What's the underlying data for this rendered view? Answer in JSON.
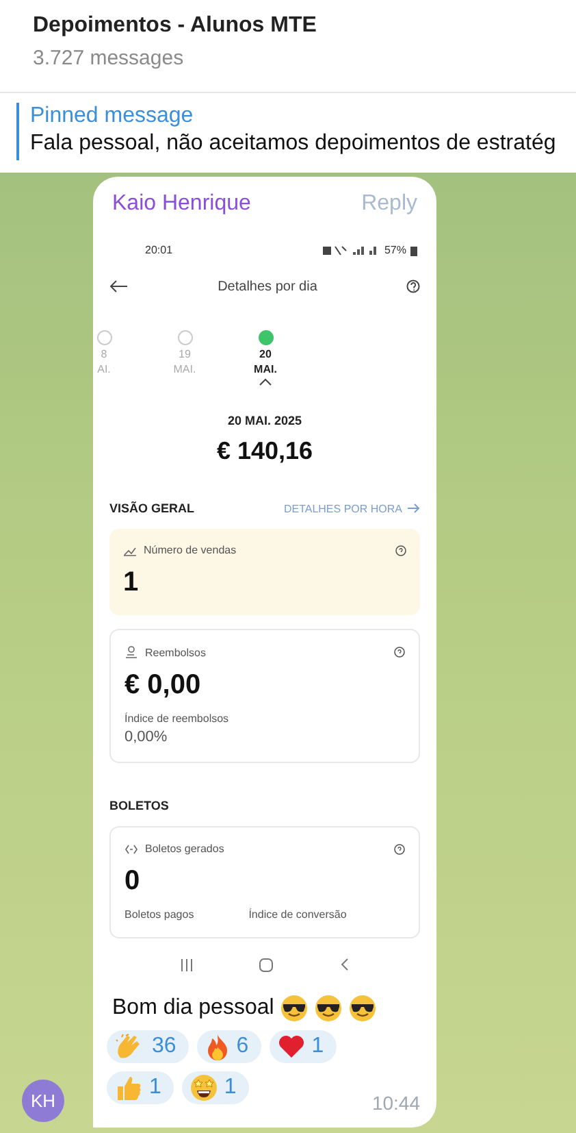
{
  "chat": {
    "title": "Depoimentos - Alunos MTE",
    "subtitle": "3.727 messages"
  },
  "pinned": {
    "label": "Pinned message",
    "text": "Fala pessoal, não aceitamos depoimentos de estratég"
  },
  "message": {
    "sender": "Kaio Henrique",
    "reply": "Reply",
    "avatar": "KH",
    "text": "Bom dia pessoal",
    "time": "10:44",
    "emojis": [
      {
        "kind": "sunglasses"
      },
      {
        "kind": "sunglasses"
      },
      {
        "kind": "sunglasses"
      }
    ],
    "reactions": [
      {
        "kind": "clap",
        "count": "36"
      },
      {
        "kind": "fire",
        "count": "6"
      },
      {
        "kind": "heart",
        "count": "1"
      },
      {
        "kind": "thumbs",
        "count": "1"
      },
      {
        "kind": "starstruck",
        "count": "1"
      }
    ],
    "screenshot": {
      "status_time": "20:01",
      "battery": "57%",
      "title": "Detalhes por dia",
      "days": [
        {
          "day": "8",
          "month": "AI.",
          "selected": false
        },
        {
          "day": "19",
          "month": "MAI.",
          "selected": false
        },
        {
          "day": "20",
          "month": "MAI.",
          "selected": true
        }
      ],
      "date": "20 MAI. 2025",
      "total": "€ 140,16",
      "sections": [
        {
          "title": "VISÃO GERAL",
          "link": "DETALHES POR HORA",
          "cards": [
            {
              "kind": "highlight",
              "label": "Número de vendas",
              "value": "1"
            },
            {
              "kind": "plain",
              "label": "Reembolsos",
              "value": "€ 0,00",
              "stats": [
                {
                  "label": "Índice de reembolsos",
                  "value": "0,00%"
                }
              ]
            }
          ]
        },
        {
          "title": "BOLETOS",
          "cards": [
            {
              "kind": "plain",
              "label": "Boletos gerados",
              "value": "0",
              "stats": [
                {
                  "label": "Boletos pagos"
                },
                {
                  "label": "Índice de conversão"
                }
              ]
            }
          ]
        }
      ]
    }
  }
}
